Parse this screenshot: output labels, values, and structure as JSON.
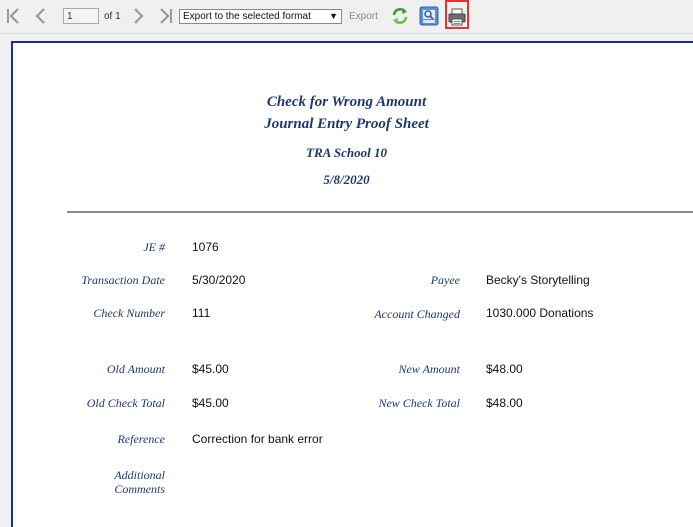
{
  "toolbar": {
    "page_number": "1",
    "page_of": "of 1",
    "export_select": "Export to the selected format",
    "export_link": "Export",
    "icons": [
      "first-page-icon",
      "previous-page-icon",
      "next-page-icon",
      "last-page-icon",
      "refresh-icon",
      "print-preview-icon",
      "print-icon"
    ],
    "highlight_color": "#e8322e"
  },
  "report": {
    "title_line1": "Check for Wrong Amount",
    "title_line2": "Journal Entry Proof Sheet",
    "school": "TRA School 10",
    "date": "5/8/2020",
    "title_color": "#1f3870",
    "border_color": "#1e2e8c"
  },
  "fields": {
    "je_label": "JE #",
    "je_value": "1076",
    "transaction_date_label": "Transaction Date",
    "transaction_date_value": "5/30/2020",
    "payee_label": "Payee",
    "payee_value": "Becky's Storytelling",
    "check_number_label": "Check Number",
    "check_number_value": "111",
    "account_changed_label": "Account Changed",
    "account_changed_value": "1030.000 Donations",
    "old_amount_label": "Old Amount",
    "old_amount_value": "$45.00",
    "new_amount_label": "New Amount",
    "new_amount_value": "$48.00",
    "old_check_total_label": "Old Check Total",
    "old_check_total_value": "$45.00",
    "new_check_total_label": "New Check Total",
    "new_check_total_value": "$48.00",
    "reference_label": "Reference",
    "reference_value": "Correction for bank error",
    "additional_comments_label_1": "Additional",
    "additional_comments_label_2": "Comments"
  }
}
